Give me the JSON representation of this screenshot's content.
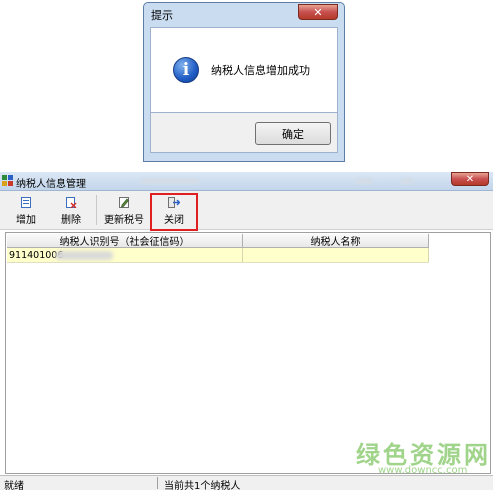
{
  "dialog": {
    "title": "提示",
    "close_glyph": "✕",
    "message": "纳税人信息增加成功",
    "ok_label": "确定",
    "icon": "info-icon"
  },
  "window": {
    "title": "纳税人信息管理",
    "close_glyph": "✕",
    "toolbar": {
      "add_label": "增加",
      "delete_label": "删除",
      "update_label": "更新税号",
      "close_label": "关闭"
    },
    "table": {
      "columns": [
        "纳税人识别号（社会征信码）",
        "纳税人名称"
      ],
      "rows": [
        [
          "911401006",
          ""
        ]
      ]
    },
    "status": {
      "left": "就绪",
      "right": "当前共1个纳税人"
    }
  },
  "watermark": {
    "text": "绿色资源网",
    "url": "www.downcc.com"
  },
  "colors": {
    "accent_red": "#e02020",
    "row_highlight": "#ffffcc",
    "watermark_green": "#9fd48a"
  }
}
